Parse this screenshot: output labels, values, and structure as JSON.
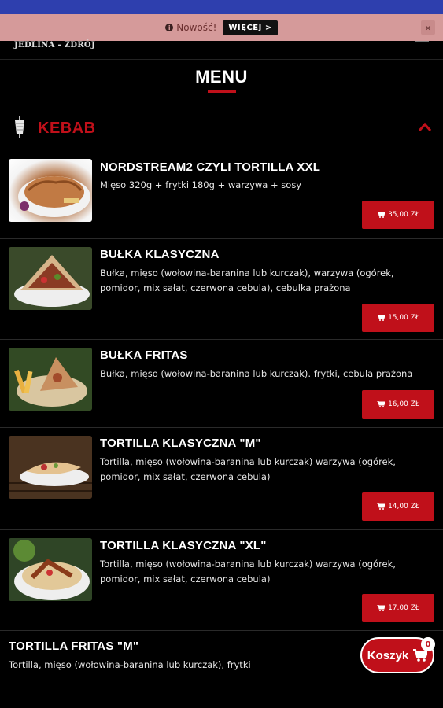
{
  "notice": {
    "text": "Nowość!",
    "button_label": "WIĘCEJ >",
    "close_label": "×"
  },
  "header": {
    "logo_text": "JEDLINA - ZDRÓJ"
  },
  "menu": {
    "title": "MENU"
  },
  "category": {
    "label": "KEBAB",
    "icon": "kebab-icon",
    "expanded_icon": "chevron-up-icon"
  },
  "items": [
    {
      "title": "NORDSTREAM2 CZYLI TORTILLA XXL",
      "description": "Mięso 320g + frytki 180g + warzywa + sosy",
      "price": "35,00 ZŁ"
    },
    {
      "title": "BUŁKA KLASYCZNA",
      "description": "Bułka, mięso (wołowina-baranina lub kurczak), warzywa (ogórek, pomidor, mix sałat, czerwona cebula), cebulka prażona",
      "price": "15,00 ZŁ"
    },
    {
      "title": "BUŁKA FRITAS",
      "description": "Bułka, mięso (wołowina-baranina lub kurczak). frytki, cebula prażona",
      "price": "16,00 ZŁ"
    },
    {
      "title": "TORTILLA KLASYCZNA \"M\"",
      "description": "Tortilla, mięso (wołowina-baranina lub kurczak) warzywa (ogórek, pomidor, mix sałat, czerwona cebula)",
      "price": "14,00 ZŁ"
    },
    {
      "title": "TORTILLA KLASYCZNA \"XL\"",
      "description": "Tortilla, mięso (wołowina-baranina lub kurczak) warzywa (ogórek, pomidor, mix sałat, czerwona cebula)",
      "price": "17,00 ZŁ"
    },
    {
      "title": "TORTILLA FRITAS \"M\"",
      "description": "Tortilla, mięso (wołowina-baranina lub kurczak), frytki"
    }
  ],
  "cart": {
    "label": "Koszyk",
    "count": "0"
  },
  "colors": {
    "accent": "#c0101a",
    "top_strip": "#2e3fae",
    "notice_bg": "#d59a9a",
    "background": "#000000"
  }
}
